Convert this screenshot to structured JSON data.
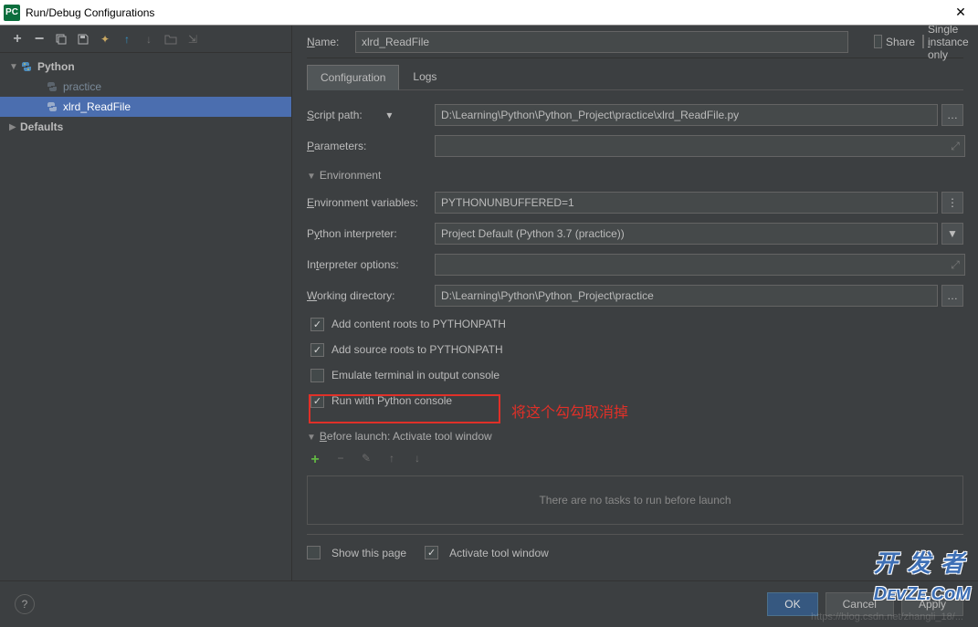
{
  "window": {
    "title": "Run/Debug Configurations"
  },
  "tree": {
    "root": "Python",
    "items": [
      "practice",
      "xlrd_ReadFile"
    ],
    "defaults": "Defaults",
    "selected": "xlrd_ReadFile"
  },
  "name_row": {
    "label": "Name:",
    "value": "xlrd_ReadFile",
    "share": "Share",
    "single": "Single instance only"
  },
  "tabs": {
    "config": "Configuration",
    "logs": "Logs"
  },
  "form": {
    "script_label": "Script path:",
    "script_value": "D:\\Learning\\Python\\Python_Project\\practice\\xlrd_ReadFile.py",
    "params_label": "Parameters:",
    "params_value": "",
    "env_header": "Environment",
    "envvars_label": "Environment variables:",
    "envvars_value": "PYTHONUNBUFFERED=1",
    "interp_label": "Python interpreter:",
    "interp_value": "Project Default (Python 3.7 (practice))",
    "interpopt_label": "Interpreter options:",
    "interpopt_value": "",
    "workdir_label": "Working directory:",
    "workdir_value": "D:\\Learning\\Python\\Python_Project\\practice",
    "chk1": "Add content roots to PYTHONPATH",
    "chk2": "Add source roots to PYTHONPATH",
    "chk3": "Emulate terminal in output console",
    "chk4": "Run with Python console",
    "before_header": "Before launch: Activate tool window",
    "no_tasks": "There are no tasks to run before launch",
    "show_page": "Show this page",
    "activate_tw": "Activate tool window"
  },
  "annotation": "将这个勾勾取消掉",
  "footer": {
    "ok": "OK",
    "cancel": "Cancel",
    "apply": "Apply"
  },
  "watermark_url": "https://blog.csdn.net/zhangli_18/...",
  "watermark_logo": "开发者 DevZe.CoM"
}
